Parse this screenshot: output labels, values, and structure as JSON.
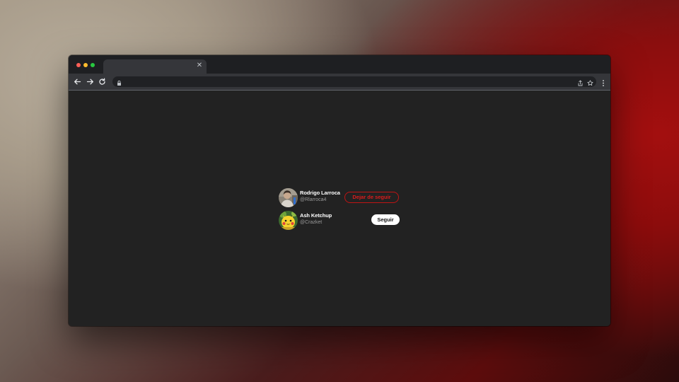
{
  "browser": {
    "tab": {
      "title": "",
      "close_icon": "close-icon"
    },
    "toolbar": {
      "back_icon": "arrow-left-icon",
      "forward_icon": "arrow-right-icon",
      "reload_icon": "reload-icon",
      "url": "",
      "lock_icon": "lock-icon",
      "share_icon": "share-icon",
      "bookmark_icon": "star-icon",
      "menu_icon": "kebab-menu-icon"
    }
  },
  "follow_list": [
    {
      "name": "Rodrigo Larroca",
      "handle": "@Rlarroca4",
      "button_label": "Dejar de seguir",
      "is_following": true
    },
    {
      "name": "Ash Ketchup",
      "handle": "@Crazket",
      "button_label": "Seguir",
      "is_following": false
    }
  ],
  "colors": {
    "page_bg": "#222222",
    "unfollow_accent": "#d91c1c",
    "follow_bg": "#ffffff"
  }
}
